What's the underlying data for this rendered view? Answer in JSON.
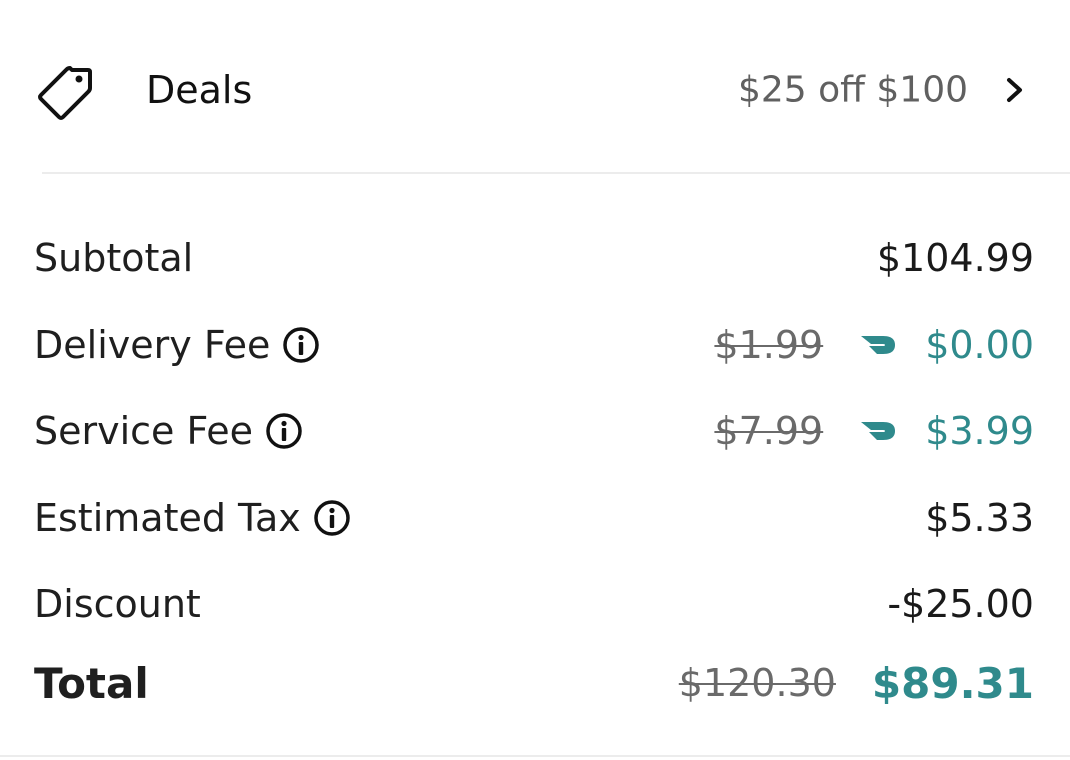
{
  "deals": {
    "label": "Deals",
    "value": "$25 off $100",
    "icon": "tag-icon"
  },
  "summary": {
    "subtotal": {
      "label": "Subtotal",
      "amount": "$104.99"
    },
    "delivery_fee": {
      "label": "Delivery Fee",
      "original": "$1.99",
      "amount": "$0.00"
    },
    "service_fee": {
      "label": "Service Fee",
      "original": "$7.99",
      "amount": "$3.99"
    },
    "estimated_tax": {
      "label": "Estimated Tax",
      "amount": "$5.33"
    },
    "discount": {
      "label": "Discount",
      "amount": "-$25.00"
    },
    "total": {
      "label": "Total",
      "original": "$120.30",
      "amount": "$89.31"
    }
  },
  "colors": {
    "accent": "#2f8a8c",
    "text": "#1a1a1a",
    "muted": "#6a6a6a",
    "divider": "#ececec"
  }
}
